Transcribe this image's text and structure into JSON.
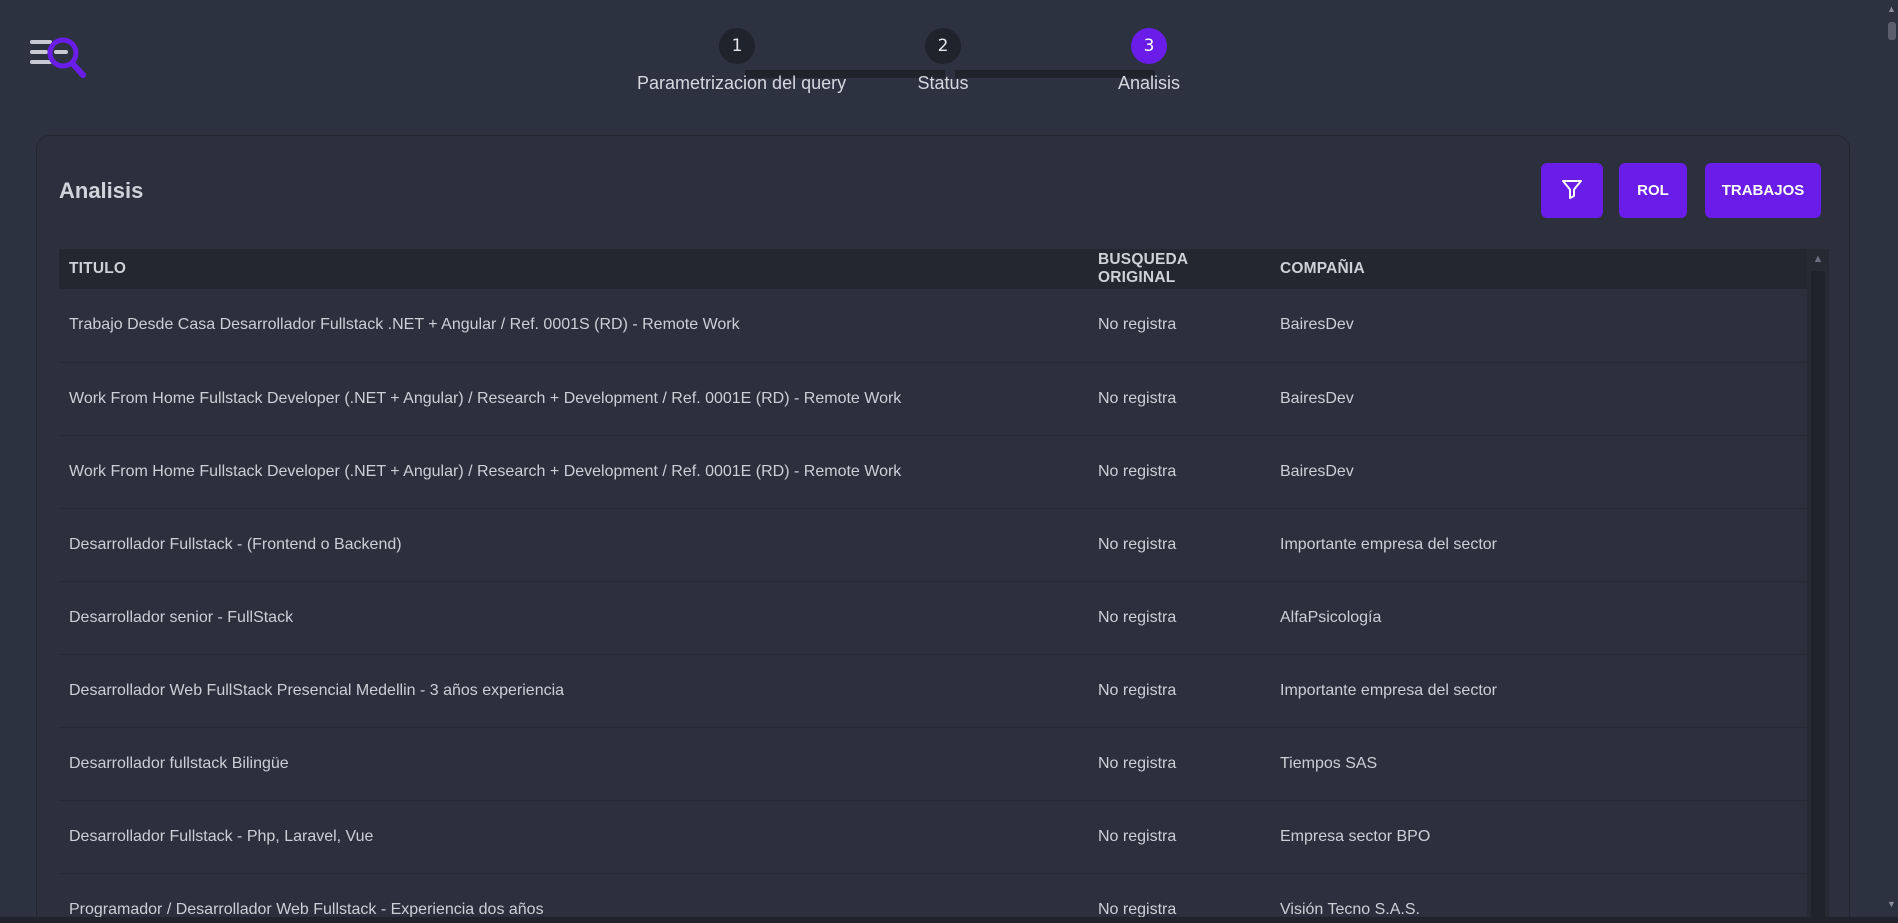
{
  "stepper": {
    "steps": [
      {
        "number": "1",
        "label": "Parametrizacion del query",
        "active": false
      },
      {
        "number": "2",
        "label": "Status",
        "active": false
      },
      {
        "number": "3",
        "label": "Analisis",
        "active": true
      }
    ]
  },
  "card": {
    "title": "Analisis",
    "buttons": {
      "filter_icon": "filter-icon",
      "rol_label": "ROL",
      "trabajos_label": "TRABAJOS"
    }
  },
  "table": {
    "headers": {
      "titulo": "TITULO",
      "busqueda": "BUSQUEDA ORIGINAL",
      "compania": "COMPAÑIA"
    },
    "rows": [
      {
        "titulo": "Trabajo Desde Casa Desarrollador Fullstack .NET + Angular / Ref. 0001S (RD) - Remote Work",
        "busqueda": "No registra",
        "compania": "BairesDev"
      },
      {
        "titulo": "Work From Home Fullstack Developer (.NET + Angular) / Research + Development / Ref. 0001E (RD) - Remote Work",
        "busqueda": "No registra",
        "compania": "BairesDev"
      },
      {
        "titulo": "Work From Home Fullstack Developer (.NET + Angular) / Research + Development / Ref. 0001E (RD) - Remote Work",
        "busqueda": "No registra",
        "compania": "BairesDev"
      },
      {
        "titulo": "Desarrollador Fullstack - (Frontend o Backend)",
        "busqueda": "No registra",
        "compania": "Importante empresa del sector"
      },
      {
        "titulo": "Desarrollador senior - FullStack",
        "busqueda": "No registra",
        "compania": "AlfaPsicología"
      },
      {
        "titulo": "Desarrollador Web FullStack Presencial Medellin - 3 años experiencia",
        "busqueda": "No registra",
        "compania": "Importante empresa del sector"
      },
      {
        "titulo": "Desarrollador fullstack Bilingüe",
        "busqueda": "No registra",
        "compania": "Tiempos SAS"
      },
      {
        "titulo": "Desarrollador Fullstack - Php, Laravel, Vue",
        "busqueda": "No registra",
        "compania": "Empresa sector BPO"
      },
      {
        "titulo": "Programador / Desarrollador Web Fullstack - Experiencia dos años",
        "busqueda": "No registra",
        "compania": "Visión Tecno S.A.S."
      }
    ]
  },
  "colors": {
    "accent": "#6a1de8",
    "background": "#2d3240",
    "header_row": "#232730"
  }
}
